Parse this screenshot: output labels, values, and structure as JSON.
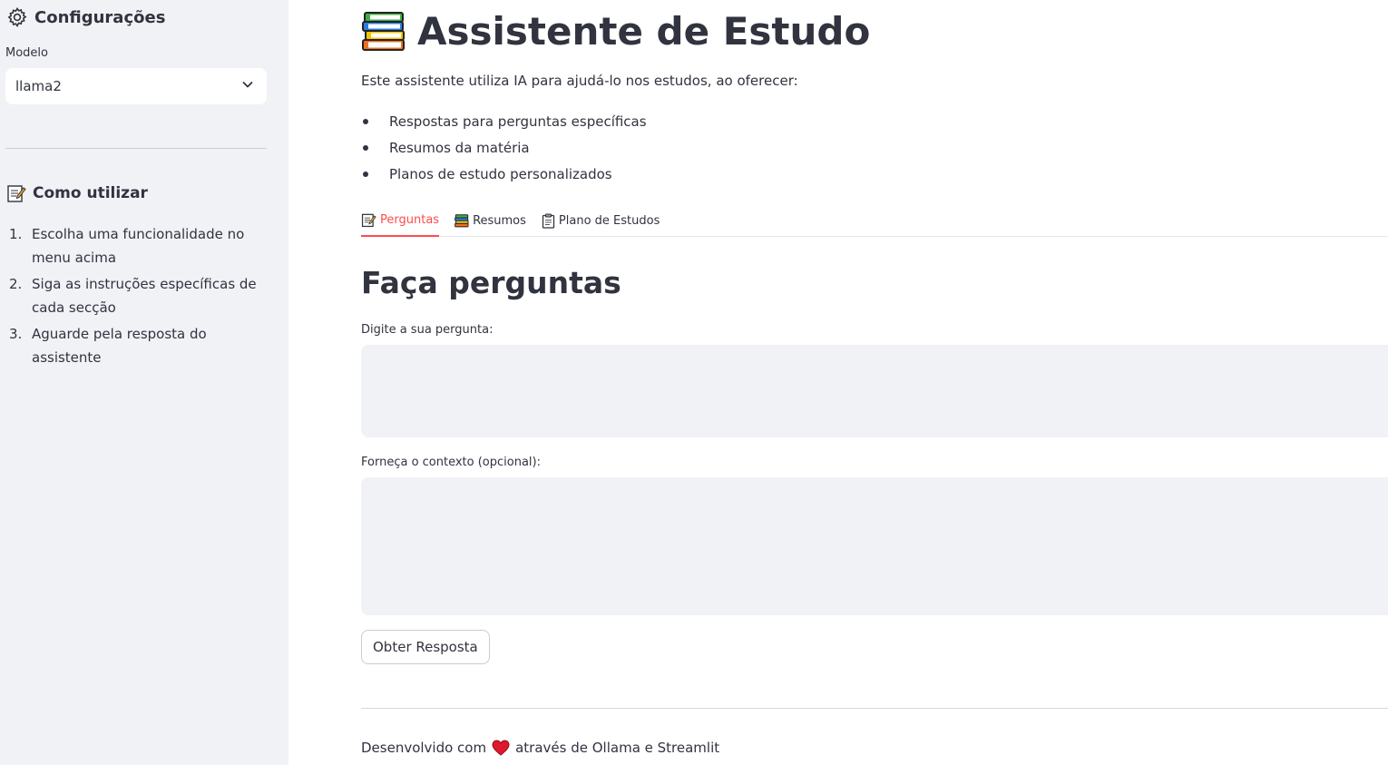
{
  "sidebar": {
    "settings_title": "Configurações",
    "model_label": "Modelo",
    "model_selected": "llama2",
    "howto_title": "Como utilizar",
    "howto_steps": [
      {
        "num": "1.",
        "text": "Escolha uma funcionalidade no menu acima"
      },
      {
        "num": "2.",
        "text": "Siga as instruções específicas de cada secção"
      },
      {
        "num": "3.",
        "text": "Aguarde pela resposta do assistente"
      }
    ]
  },
  "main": {
    "title": "Assistente de Estudo",
    "intro": "Este assistente utiliza IA para ajudá-lo nos estudos, ao oferecer:",
    "features": [
      "Respostas para perguntas específicas",
      "Resumos da matéria",
      "Planos de estudo personalizados"
    ],
    "tabs": [
      {
        "label": "Perguntas",
        "icon": "memo-icon",
        "active": true
      },
      {
        "label": "Resumos",
        "icon": "books-icon",
        "active": false
      },
      {
        "label": "Plano de Estudos",
        "icon": "clipboard-icon",
        "active": false
      }
    ],
    "section_title": "Faça perguntas",
    "question_label": "Digite a sua pergunta:",
    "question_value": "",
    "context_label": "Forneça o contexto (opcional):",
    "context_value": "",
    "submit_label": "Obter Resposta",
    "footer_before": "Desenvolvido com",
    "footer_after": "através de Ollama e Streamlit"
  },
  "colors": {
    "accent": "#ff4b4b",
    "sidebar_bg": "#f0f2f6",
    "text": "#31333f",
    "heart": "#e0182d"
  }
}
